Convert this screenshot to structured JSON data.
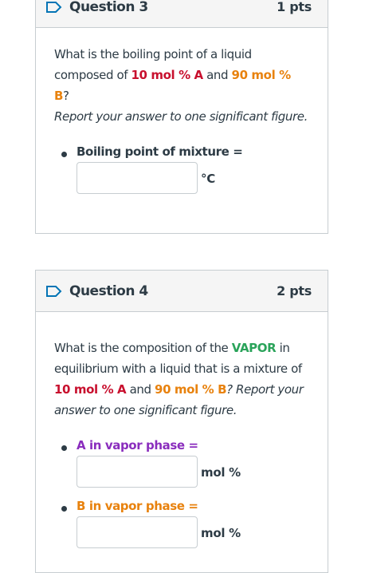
{
  "q3": {
    "title": "Question 3",
    "pts": "1 pts",
    "text": {
      "p1": "What is the boiling point of a liquid composed of ",
      "a_pct": "10 mol % A",
      "and": " and ",
      "b_pct": "90 mol % B",
      "q": "?",
      "instr": "Report your answer to one significant figure."
    },
    "item_label": "Boiling point of mixture =",
    "unit": "°C",
    "input_value": ""
  },
  "q4": {
    "title": "Question 4",
    "pts": "2 pts",
    "text": {
      "p1": "What is the composition of the ",
      "vapor": "VAPOR",
      "p2": " in equilibrium with a liquid that is a mixture of ",
      "a_pct": "10 mol % A",
      "and": " and ",
      "b_pct": "90 mol % B",
      "q": "? Report your answer to one significant figure."
    },
    "items": [
      {
        "label": "A in vapor phase =",
        "unit": "mol %",
        "input_value": ""
      },
      {
        "label": "B in vapor phase =",
        "unit": "mol %",
        "input_value": ""
      }
    ]
  },
  "colors": {
    "a": "#c8102e",
    "b": "#e8820e",
    "vapor": "#2aa35a",
    "a_label": "#8a2dbd",
    "b_label": "#e8820e",
    "flag": "#0374b5"
  }
}
